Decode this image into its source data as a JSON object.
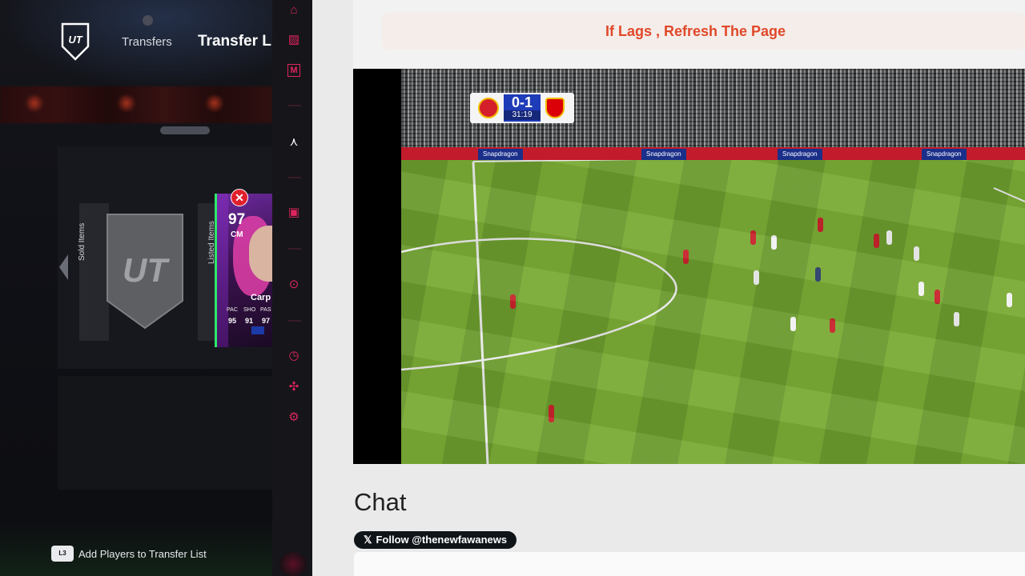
{
  "game": {
    "nav": {
      "transfers": "Transfers",
      "transfer_list": "Transfer List"
    },
    "tiles": {
      "sold_items": "Sold Items",
      "listed_items": "Listed Items",
      "placeholder_logo": "UT"
    },
    "player_card": {
      "rating": "97",
      "position": "CM",
      "name": "Carp",
      "stat_labels": [
        "PAC",
        "SHO",
        "PAS"
      ],
      "stat_values": [
        "95",
        "91",
        "97"
      ]
    },
    "bottom_hint": {
      "button": "L3",
      "label": "Add Players to Transfer List"
    }
  },
  "extension_sidebar": {
    "icons": [
      "stamp-icon",
      "card-pack-icon",
      "m-box-icon",
      "sword-icon",
      "twitch-icon",
      "play-circle-icon",
      "clock-icon",
      "puzzle-icon",
      "gear-icon"
    ],
    "accent": "#e0245e"
  },
  "stream_page": {
    "banner": "If Lags , Refresh The Page",
    "banner_color": "#e0482a",
    "scoreboard": {
      "score": "0-1",
      "clock": "31:19"
    },
    "ad_text": "Snapdragon",
    "chat_title": "Chat",
    "follow_button": "Follow @thenewfawanews"
  }
}
